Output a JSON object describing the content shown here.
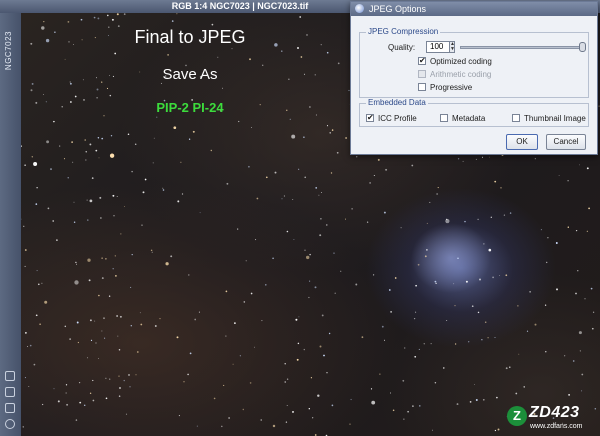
{
  "window": {
    "title": "RGB 1:4 NGC7023 | NGC7023.tif",
    "side_label": "NGC7023"
  },
  "overlay": {
    "line1": "Final to JPEG",
    "line2": "Save As",
    "line3": "PIP-2 PI-24"
  },
  "dialog": {
    "title": "JPEG Options",
    "compression": {
      "group_title": "JPEG Compression",
      "quality_label": "Quality:",
      "quality_value": "100",
      "quality_fraction": 1.0,
      "options": [
        {
          "label": "Optimized coding",
          "checked": true,
          "enabled": true
        },
        {
          "label": "Arithmetic coding",
          "checked": false,
          "enabled": false
        },
        {
          "label": "Progressive",
          "checked": false,
          "enabled": true
        }
      ]
    },
    "embedded": {
      "group_title": "Embedded Data",
      "options": [
        {
          "label": "ICC Profile",
          "checked": true
        },
        {
          "label": "Metadata",
          "checked": false
        },
        {
          "label": "Thumbnail Image",
          "checked": false
        }
      ]
    },
    "ok_label": "OK",
    "cancel_label": "Cancel"
  },
  "watermark": {
    "badge": "Z",
    "text": "ZD423",
    "url": "www.zdfans.com"
  },
  "colors": {
    "accent_green": "#3cdc3c",
    "group_title_blue": "#2d4a8a",
    "brand_green": "#1c8f3a"
  }
}
